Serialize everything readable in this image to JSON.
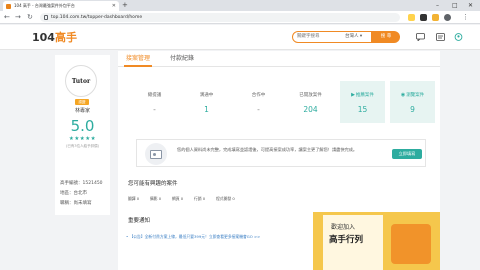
{
  "browser": {
    "tab_title": "104 高手 - 台灣最強案件外包平台",
    "url": "top.104.com.tw/topper-dashboard/home"
  },
  "site": {
    "logo_num": "104",
    "logo_text": "高手",
    "search_placeholder": "關鍵字搜尋",
    "search_category": "台灣人 ▾",
    "search_button": "搜 尋"
  },
  "profile": {
    "avatar_text": "Tutor",
    "badge": "認證",
    "name": "林專家",
    "score": "5.0",
    "stars": "★★★★★",
    "reviews": "(已有3位人給予評價)",
    "info": [
      "高手編號：1521450",
      "地區：台北市",
      "職稱：尚未填寫"
    ]
  },
  "tabs": {
    "case_mgmt": "接案管理",
    "payment": "付款紀錄"
  },
  "stats": [
    {
      "label": "總提議",
      "value": "-",
      "icon": "",
      "highlight": false
    },
    {
      "label": "溝通中",
      "value": "1",
      "icon": "",
      "highlight": false
    },
    {
      "label": "合作中",
      "value": "-",
      "icon": "",
      "highlight": false
    },
    {
      "label": "已開放案件",
      "value": "204",
      "icon": "",
      "highlight": false
    },
    {
      "label": "推薦案件",
      "value": "15",
      "icon": "▶",
      "highlight": true
    },
    {
      "label": "瀏覽案件",
      "value": "9",
      "icon": "◉",
      "highlight": true
    }
  ],
  "notice": {
    "text": "您的個人資料尚未完整，完成填寫並認證後，可提高接案成功率，讓案主更了解您！請盡快完成。",
    "button": "立即填寫"
  },
  "interest": {
    "title": "您可能有興趣的案件",
    "chips": [
      "翻譯 0",
      "攝影 0",
      "網頁 0",
      "行銷 0",
      "程式開發 0"
    ]
  },
  "notifications": {
    "title": "重要通知",
    "items": [
      "• 【公告】全新付費方案上線，最低只要399元！立即查看更多接案機會GO >>"
    ]
  },
  "ad": {
    "line1": "歡迎加入",
    "line2": "高手行列"
  },
  "colors": {
    "accent": "#f08a24",
    "teal": "#2dac9f"
  }
}
